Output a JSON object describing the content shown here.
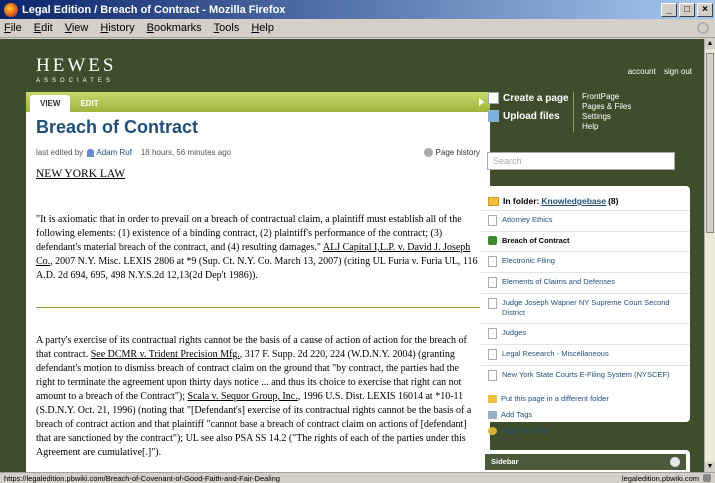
{
  "window": {
    "title": "Legal Edition / Breach of Contract - Mozilla Firefox"
  },
  "menu": [
    "File",
    "Edit",
    "View",
    "History",
    "Bookmarks",
    "Tools",
    "Help"
  ],
  "header": {
    "logo_name": "HEWES",
    "logo_sub": "ASSOCIATES",
    "account": "account",
    "signout": "sign out"
  },
  "tabs": {
    "view": "VIEW",
    "edit": "EDIT"
  },
  "page": {
    "title": "Breach of Contract",
    "last_edited_prefix": "last edited by",
    "author": "Adam Ruf",
    "time_ago": "18 hours, 56 minutes ago",
    "history": "Page history"
  },
  "content": {
    "heading": "NEW YORK LAW",
    "p1_a": "\"It is axiomatic that in order to prevail on a breach of contractual claim, a plaintiff must establish all of the following elements: (1) existence of a binding contract, (2) plaintiff's performance of the contract; (3) defendant's material breach of the contract, and (4) resulting damages.\" ",
    "p1_link": "ALJ Capital I,L.P. v. David J. Joseph Co.",
    "p1_b": ", 2007 N.Y. Misc. LEXIS 2806 at *9 (Sup. Ct. N.Y. Co. March 13, 2007) (citing UL Furia v. Furia UL, 116 A.D. 2d 694, 695, 498 N.Y.S.2d 12,13(2d Dep't 1986)).",
    "p2_a": "A party's exercise of its contractual rights cannot be the basis of a cause of action of action for the breach of that contract.  ",
    "p2_link1": "See DCMR v. Trident Precision Mfg.",
    "p2_b": ", 317 F. Supp. 2d 220, 224 (W.D.N.Y. 2004) (granting defendant's motion to dismiss breach of contract claim on the ground that \"by contract, the parties had the right to terminate the agreement upon thirty days notice ... and thus its choice to exercise that right can not amount to a breach of the Contract\"); ",
    "p2_link2": "Scala v. Sequor Group, Inc.",
    "p2_c": ", 1996 U.S. Dist. LEXIS 16014 at *10-11 (S.D.N.Y. Oct. 21, 1996) (noting that \"[Defendant's] exercise of its contractual rights cannot be the basis of a breach of contract action and that plaintiff \"cannot base a breach of contract claim on actions of [defendant] that are sanctioned by the contract\"); UL see also PSA SS 14.2 (\"The rights of each of the parties under this Agreement are cumulative[.]\")."
  },
  "side": {
    "create_page": "Create a page",
    "upload_files": "Upload files",
    "links": [
      "FrontPage",
      "Pages & Files",
      "Settings",
      "Help"
    ],
    "search_placeholder": "Search"
  },
  "folder": {
    "prefix": "In folder:",
    "name": "Knowledgebase",
    "count": "(8)",
    "items": [
      "Attorney Ethics",
      "Breach of Contract",
      "Electronic Filing",
      "Elements of Claims and Defenses",
      "Judge Joseph Wapner NY Supreme Court Second District",
      "Judges",
      "Legal Research - Miscellaneous",
      "New York State Courts E-Filing System (NYSCEF)"
    ],
    "move": "Put this page in a different folder",
    "add_tags": "Add Tags",
    "security": "Page Security"
  },
  "sidebar": {
    "title": "Sidebar"
  },
  "status": {
    "url": "https://legaledition.pbwiki.com/Breach-of-Covenant-of-Good-Faith-and-Fair-Dealing",
    "host": "legaledition.pbwiki.com"
  }
}
